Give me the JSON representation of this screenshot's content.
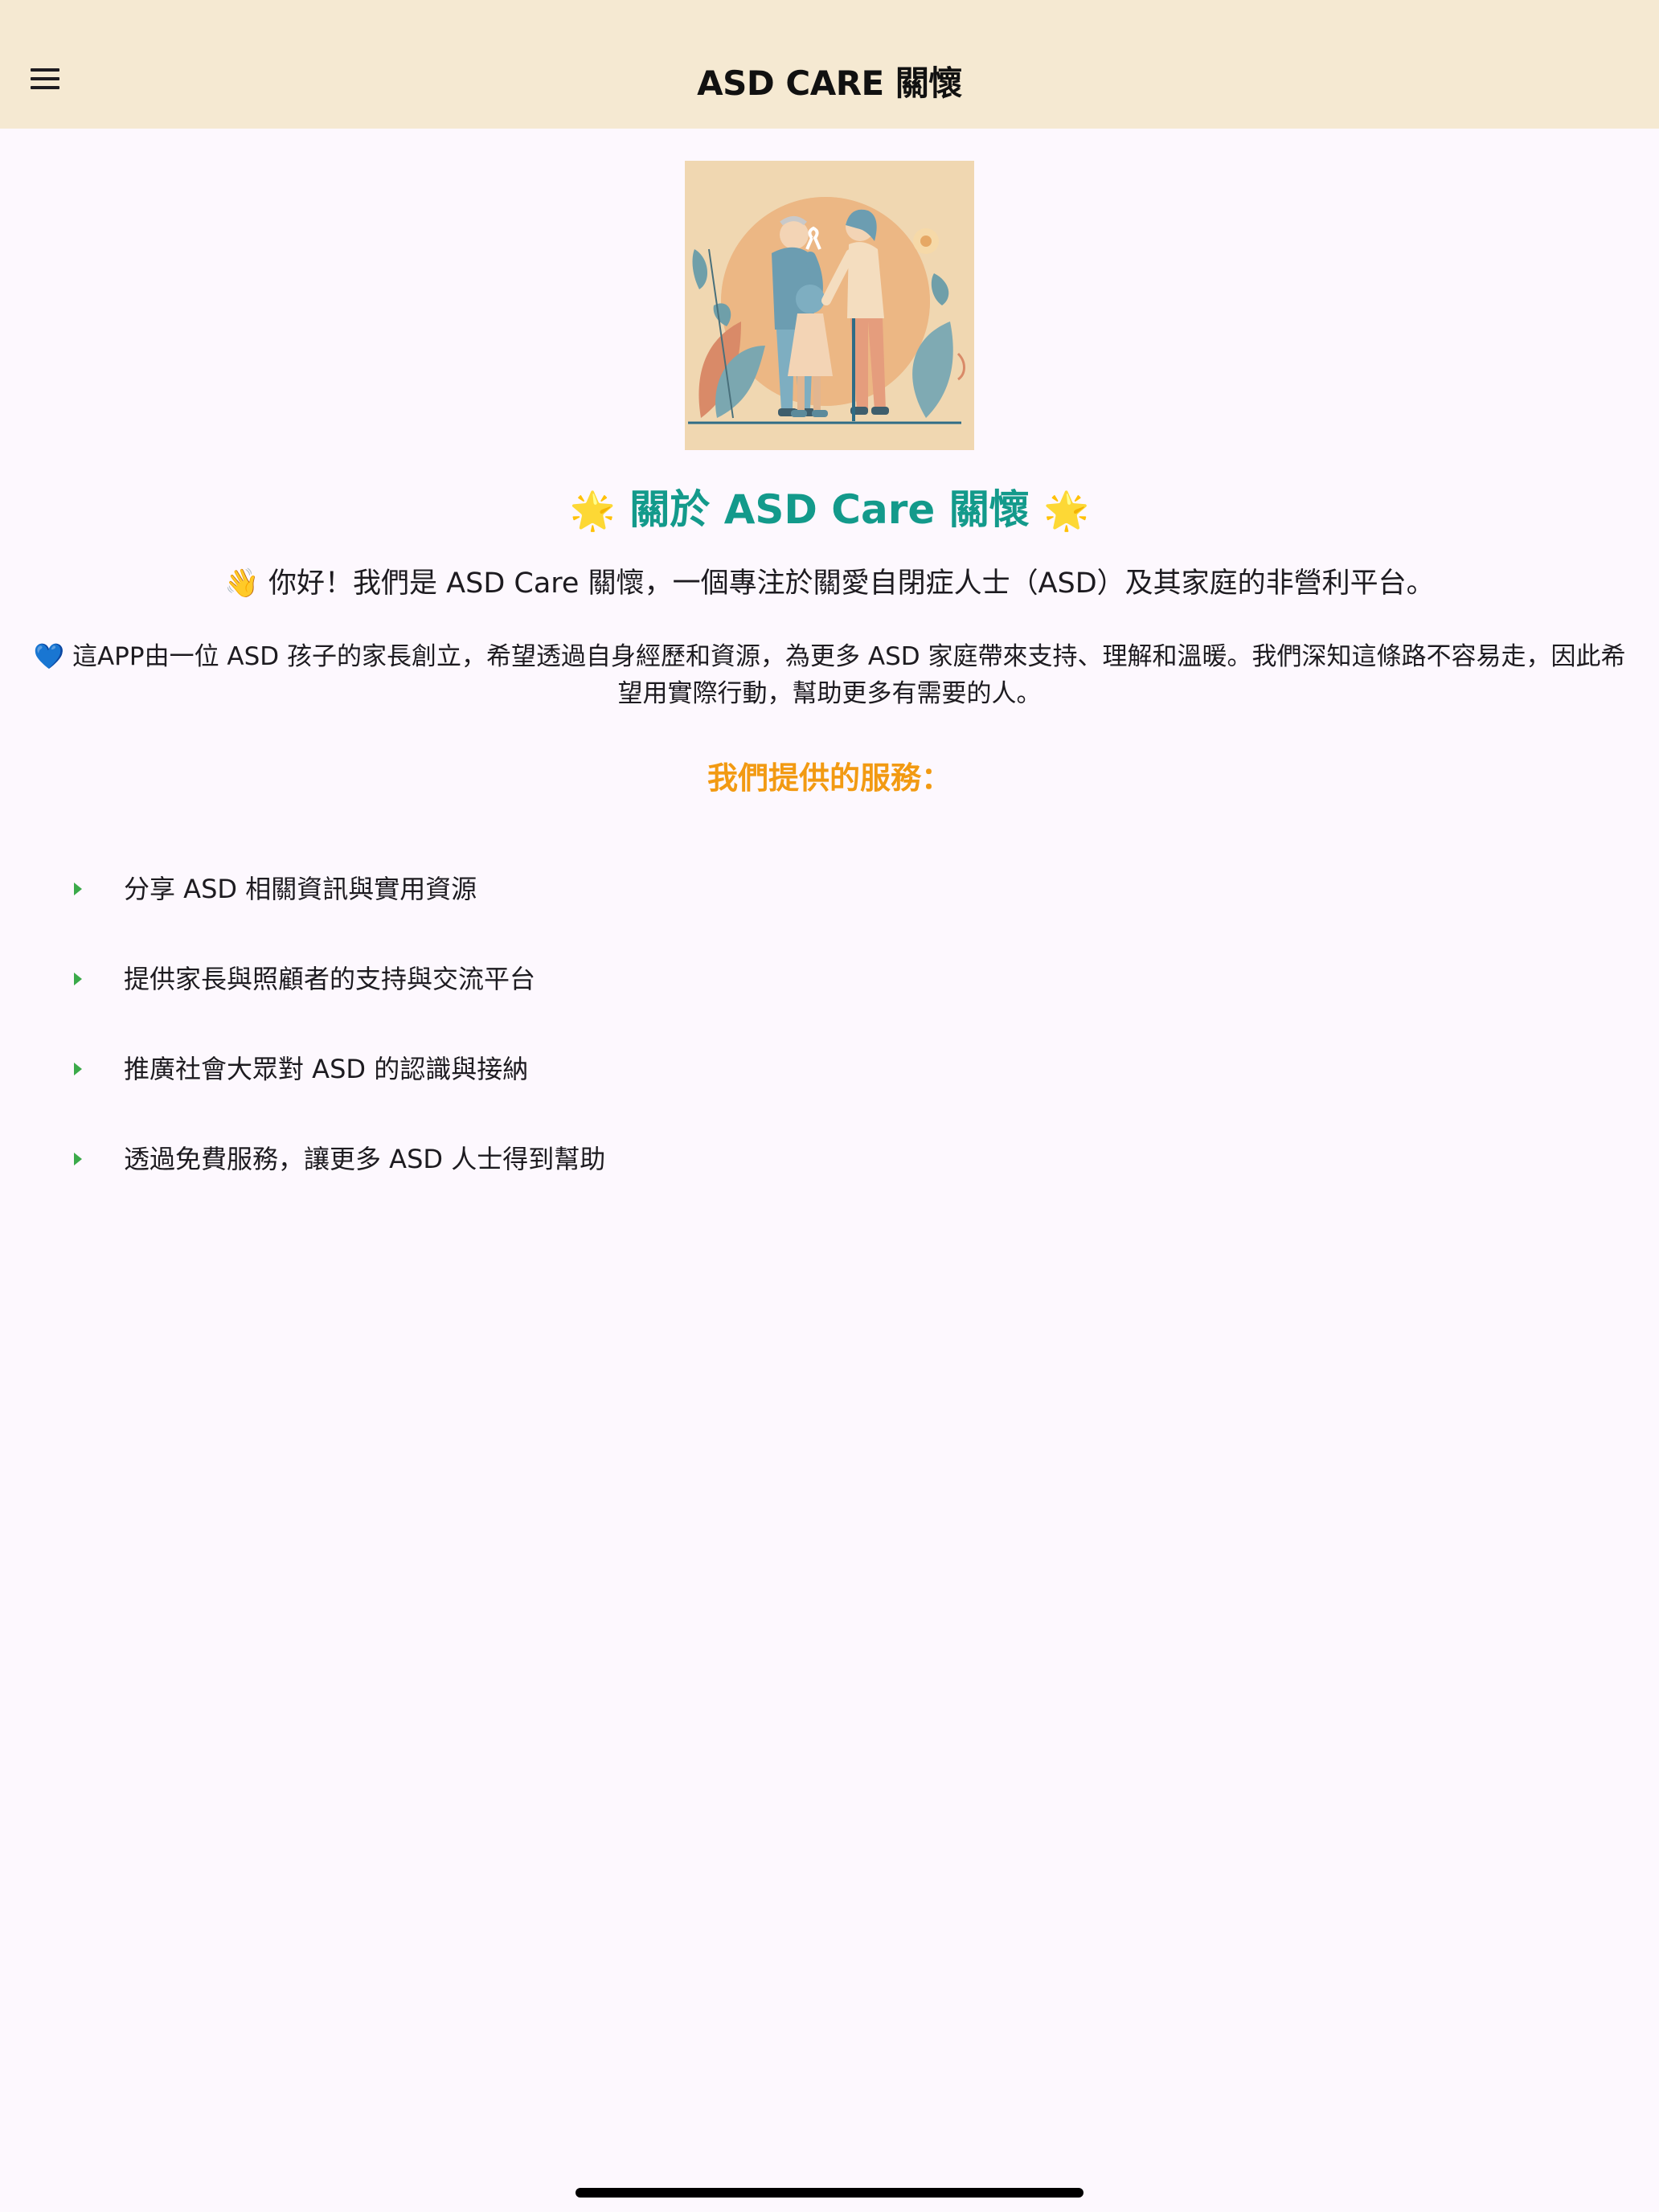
{
  "app_bar": {
    "title": "ASD CARE 關懷",
    "menu_icon": "hamburger-menu-icon",
    "background": "#F5E9D2"
  },
  "hero": {
    "illustration": "family-caring-for-child-illustration"
  },
  "about": {
    "title_emoji": "🌟",
    "title": "關於 ASD Care 關懷",
    "title_color": "#139A8B",
    "greeting_emoji": "👋",
    "greeting": "你好！我們是 ASD Care 關懷，一個專注於關愛自閉症人士（ASD）及其家庭的非營利平台。",
    "intro_emoji": "💙",
    "intro": "這APP由一位 ASD 孩子的家長創立，希望透過自身經歷和資源，為更多 ASD 家庭帶來支持、理解和溫暖。我們深知這條路不容易走，因此希望用實際行動，幫助更多有需要的人。"
  },
  "services": {
    "heading": "我們提供的服務：",
    "heading_color": "#F29A12",
    "bullet_color": "#3BAA4A",
    "items": [
      "分享 ASD 相關資訊與實用資源",
      "提供家長與照顧者的支持與交流平台",
      "推廣社會大眾對 ASD 的認識與接納",
      "透過免費服務，讓更多 ASD 人士得到幫助"
    ]
  }
}
